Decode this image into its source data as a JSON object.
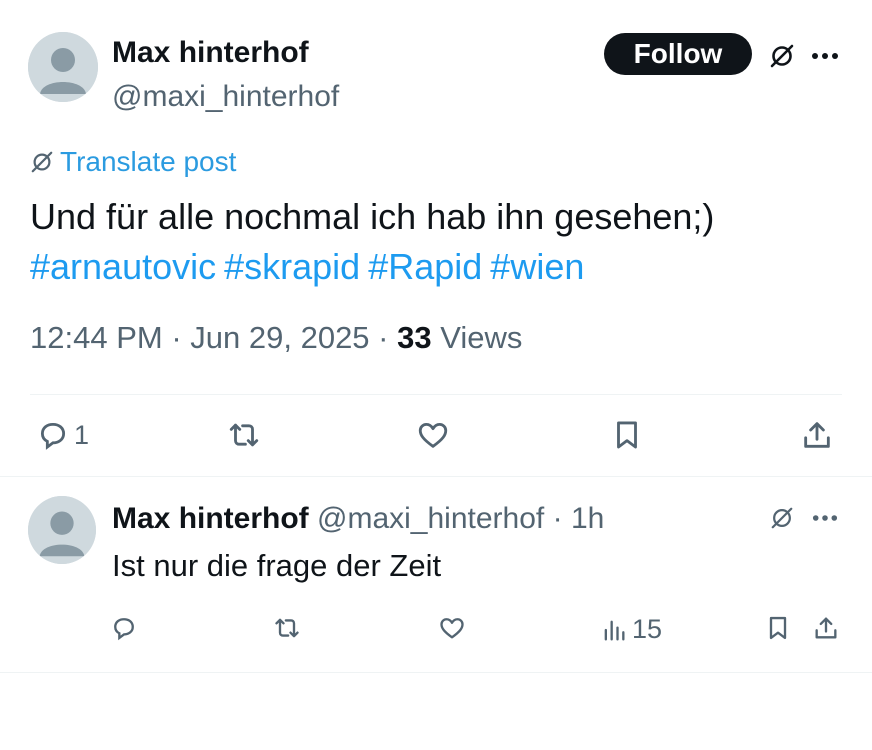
{
  "main_post": {
    "author": {
      "display_name": "Max hinterhof",
      "handle": "@maxi_hinterhof"
    },
    "follow_label": "Follow",
    "translate_label": "Translate post",
    "text": "Und für alle nochmal ich hab ihn gesehen;)",
    "hashtags": [
      "#arnautovic",
      "#skrapid",
      "#Rapid",
      "#wien"
    ],
    "time": "12:44 PM",
    "date": "Jun 29, 2025",
    "separator": "·",
    "views_count": "33",
    "views_label": "Views",
    "actions": {
      "reply_count": "1"
    }
  },
  "reply": {
    "author": {
      "display_name": "Max hinterhof",
      "handle": "@maxi_hinterhof"
    },
    "separator": "·",
    "time_ago": "1h",
    "text": "Ist nur die frage der Zeit",
    "analytics_count": "15"
  },
  "colors": {
    "accent": "#1d9bf0",
    "text": "#0f1419",
    "secondary": "#536471",
    "divider": "#eff3f4"
  },
  "icons": [
    "grok-icon",
    "more-icon",
    "reply-icon",
    "repost-icon",
    "like-icon",
    "bookmark-icon",
    "share-icon",
    "analytics-icon",
    "translate-icon"
  ]
}
